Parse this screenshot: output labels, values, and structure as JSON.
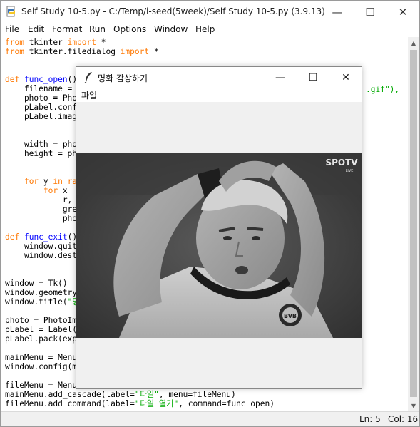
{
  "window": {
    "title": "Self Study 10-5.py - C:/Temp/i-seed(5week)/Self Study 10-5.py (3.9.13)",
    "minimize_glyph": "—",
    "maximize_glyph": "☐",
    "close_glyph": "✕"
  },
  "menu": [
    "File",
    "Edit",
    "Format",
    "Run",
    "Options",
    "Window",
    "Help"
  ],
  "code": [
    [
      {
        "t": "from",
        "c": "kw"
      },
      {
        "t": " tkinter "
      },
      {
        "t": "import",
        "c": "kw"
      },
      {
        "t": " *"
      }
    ],
    [
      {
        "t": "from",
        "c": "kw"
      },
      {
        "t": " tkinter.filedialog "
      },
      {
        "t": "import",
        "c": "kw"
      },
      {
        "t": " *"
      }
    ],
    [],
    [],
    [
      {
        "t": "def",
        "c": "kw"
      },
      {
        "t": " "
      },
      {
        "t": "func_open",
        "c": "fn"
      },
      {
        "t": "():"
      }
    ],
    [
      {
        "t": "    filename ="
      }
    ],
    [
      {
        "t": "    photo = Phot"
      }
    ],
    [
      {
        "t": "    pLabel.conf"
      }
    ],
    [
      {
        "t": "    pLabel.imag"
      }
    ],
    [],
    [],
    [
      {
        "t": "    width = pho"
      }
    ],
    [
      {
        "t": "    height = ph"
      }
    ],
    [],
    [],
    [
      {
        "t": "    "
      },
      {
        "t": "for",
        "c": "kw"
      },
      {
        "t": " y "
      },
      {
        "t": "in",
        "c": "kw"
      },
      {
        "t": " "
      },
      {
        "t": "ra",
        "c": "kw"
      }
    ],
    [
      {
        "t": "        "
      },
      {
        "t": "for",
        "c": "kw"
      },
      {
        "t": " x"
      }
    ],
    [
      {
        "t": "            r,"
      }
    ],
    [
      {
        "t": "            gre"
      }
    ],
    [
      {
        "t": "            pho"
      }
    ],
    [],
    [
      {
        "t": "def",
        "c": "kw"
      },
      {
        "t": " "
      },
      {
        "t": "func_exit",
        "c": "fn"
      },
      {
        "t": "()"
      }
    ],
    [
      {
        "t": "    window.quit"
      }
    ],
    [
      {
        "t": "    window.dest"
      }
    ],
    [],
    [],
    [
      {
        "t": "window = Tk()"
      }
    ],
    [
      {
        "t": "window.geometry"
      }
    ],
    [
      {
        "t": "window.title("
      },
      {
        "t": "\"명",
        "c": "str"
      }
    ],
    [],
    [
      {
        "t": "photo = PhotoIm"
      }
    ],
    [
      {
        "t": "pLabel = Label("
      }
    ],
    [
      {
        "t": "pLabel.pack(exp"
      }
    ],
    [],
    [
      {
        "t": "mainMenu = Menu"
      }
    ],
    [
      {
        "t": "window.config(m"
      }
    ],
    [],
    [
      {
        "t": "fileMenu = Menu(mainMenu)"
      }
    ],
    [
      {
        "t": "mainMenu.add_cascade(label="
      },
      {
        "t": "\"파일\"",
        "c": "str"
      },
      {
        "t": ", menu=fileMenu)"
      }
    ],
    [
      {
        "t": "fileMenu.add_command(label="
      },
      {
        "t": "\"파일 열기\"",
        "c": "str"
      },
      {
        "t": ", command=func_open)"
      }
    ]
  ],
  "code_overflow": ".gif\"),",
  "status": {
    "line": "Ln: 5",
    "col": "Col: 16"
  },
  "tk_window": {
    "title": "명화 감상하기",
    "menu_label": "파일",
    "minimize_glyph": "—",
    "maximize_glyph": "☐",
    "close_glyph": "✕",
    "watermark": "SPOTV",
    "watermark_sub": "LIVE"
  }
}
